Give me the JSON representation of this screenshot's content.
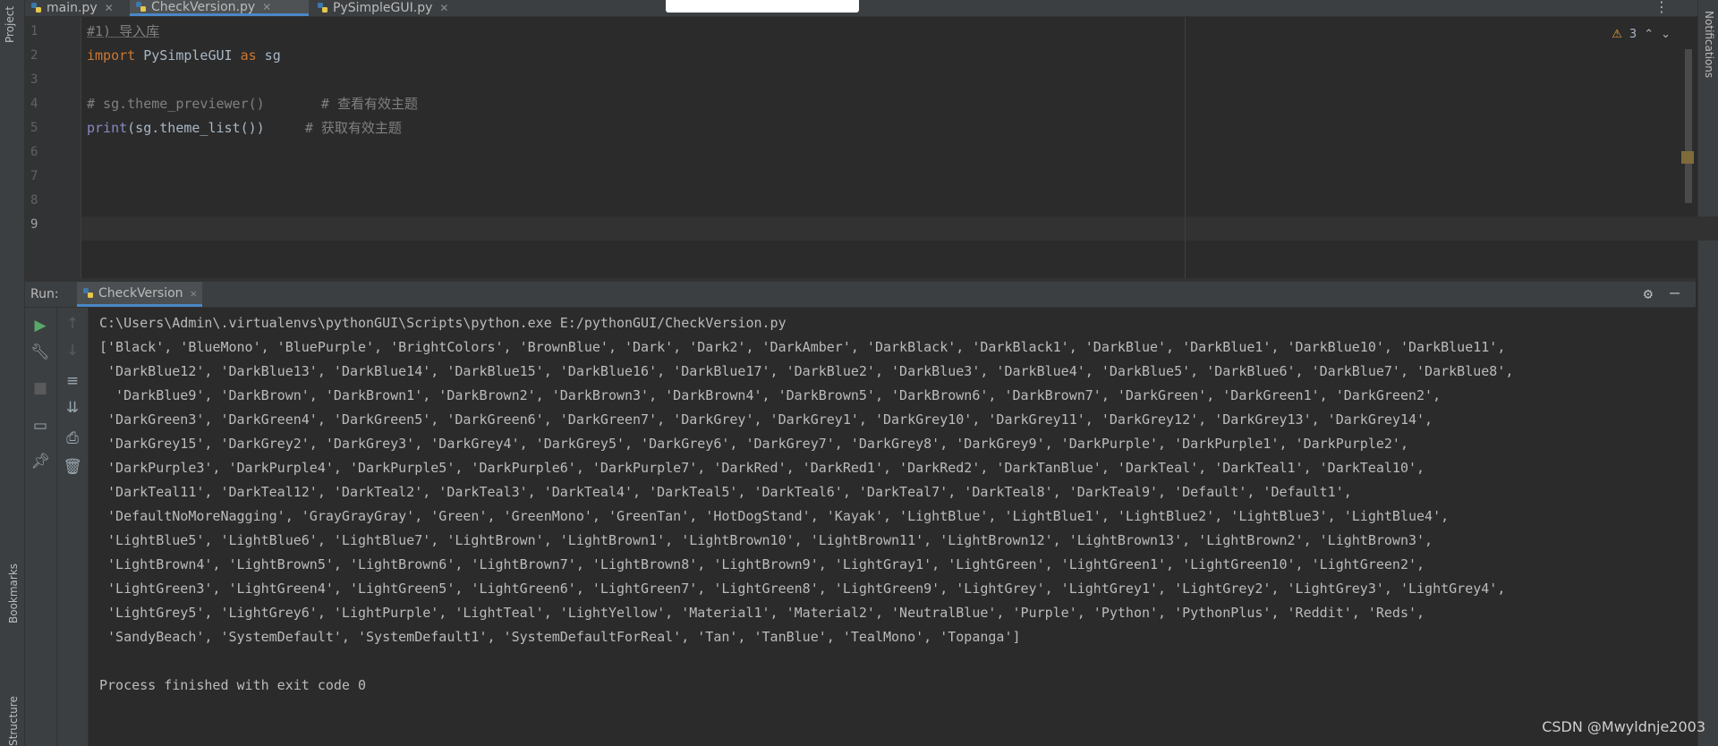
{
  "sidebar_left": {
    "project": "Project",
    "bookmarks": "Bookmarks",
    "structure": "Structure"
  },
  "sidebar_right": {
    "notifications": "Notifications"
  },
  "tabs": [
    {
      "label": "main.py"
    },
    {
      "label": "CheckVersion.py"
    },
    {
      "label": "PySimpleGUI.py"
    }
  ],
  "editor": {
    "warnings_count": "3",
    "lines": [
      {
        "num": "1",
        "text": "#1) 导入库"
      },
      {
        "num": "2",
        "kw1": "import",
        "name": " PySimpleGUI ",
        "kw2": "as",
        "alias": " sg"
      },
      {
        "num": "3",
        "text": ""
      },
      {
        "num": "4",
        "text": "# sg.theme_previewer()       # 查看有效主题"
      },
      {
        "num": "5",
        "fn": "print",
        "rest": "(sg.theme_list())",
        "comment": "     # 获取有效主题"
      },
      {
        "num": "6",
        "text": ""
      },
      {
        "num": "7",
        "text": ""
      },
      {
        "num": "8",
        "text": ""
      },
      {
        "num": "9",
        "text": ""
      }
    ]
  },
  "run": {
    "label": "Run:",
    "tab": "CheckVersion",
    "output": [
      "C:\\Users\\Admin\\.virtualenvs\\pythonGUI\\Scripts\\python.exe E:/pythonGUI/CheckVersion.py",
      "['Black', 'BlueMono', 'BluePurple', 'BrightColors', 'BrownBlue', 'Dark', 'Dark2', 'DarkAmber', 'DarkBlack', 'DarkBlack1', 'DarkBlue', 'DarkBlue1', 'DarkBlue10', 'DarkBlue11',",
      " 'DarkBlue12', 'DarkBlue13', 'DarkBlue14', 'DarkBlue15', 'DarkBlue16', 'DarkBlue17', 'DarkBlue2', 'DarkBlue3', 'DarkBlue4', 'DarkBlue5', 'DarkBlue6', 'DarkBlue7', 'DarkBlue8',",
      "  'DarkBlue9', 'DarkBrown', 'DarkBrown1', 'DarkBrown2', 'DarkBrown3', 'DarkBrown4', 'DarkBrown5', 'DarkBrown6', 'DarkBrown7', 'DarkGreen', 'DarkGreen1', 'DarkGreen2',",
      " 'DarkGreen3', 'DarkGreen4', 'DarkGreen5', 'DarkGreen6', 'DarkGreen7', 'DarkGrey', 'DarkGrey1', 'DarkGrey10', 'DarkGrey11', 'DarkGrey12', 'DarkGrey13', 'DarkGrey14',",
      " 'DarkGrey15', 'DarkGrey2', 'DarkGrey3', 'DarkGrey4', 'DarkGrey5', 'DarkGrey6', 'DarkGrey7', 'DarkGrey8', 'DarkGrey9', 'DarkPurple', 'DarkPurple1', 'DarkPurple2',",
      " 'DarkPurple3', 'DarkPurple4', 'DarkPurple5', 'DarkPurple6', 'DarkPurple7', 'DarkRed', 'DarkRed1', 'DarkRed2', 'DarkTanBlue', 'DarkTeal', 'DarkTeal1', 'DarkTeal10',",
      " 'DarkTeal11', 'DarkTeal12', 'DarkTeal2', 'DarkTeal3', 'DarkTeal4', 'DarkTeal5', 'DarkTeal6', 'DarkTeal7', 'DarkTeal8', 'DarkTeal9', 'Default', 'Default1',",
      " 'DefaultNoMoreNagging', 'GrayGrayGray', 'Green', 'GreenMono', 'GreenTan', 'HotDogStand', 'Kayak', 'LightBlue', 'LightBlue1', 'LightBlue2', 'LightBlue3', 'LightBlue4',",
      " 'LightBlue5', 'LightBlue6', 'LightBlue7', 'LightBrown', 'LightBrown1', 'LightBrown10', 'LightBrown11', 'LightBrown12', 'LightBrown13', 'LightBrown2', 'LightBrown3',",
      " 'LightBrown4', 'LightBrown5', 'LightBrown6', 'LightBrown7', 'LightBrown8', 'LightBrown9', 'LightGray1', 'LightGreen', 'LightGreen1', 'LightGreen10', 'LightGreen2',",
      " 'LightGreen3', 'LightGreen4', 'LightGreen5', 'LightGreen6', 'LightGreen7', 'LightGreen8', 'LightGreen9', 'LightGrey', 'LightGrey1', 'LightGrey2', 'LightGrey3', 'LightGrey4',",
      " 'LightGrey5', 'LightGrey6', 'LightPurple', 'LightTeal', 'LightYellow', 'Material1', 'Material2', 'NeutralBlue', 'Purple', 'Python', 'PythonPlus', 'Reddit', 'Reds',",
      " 'SandyBeach', 'SystemDefault', 'SystemDefault1', 'SystemDefaultForReal', 'Tan', 'TanBlue', 'TealMono', 'Topanga']",
      "",
      "Process finished with exit code 0"
    ]
  },
  "watermark": "CSDN @Mwyldnje2003"
}
